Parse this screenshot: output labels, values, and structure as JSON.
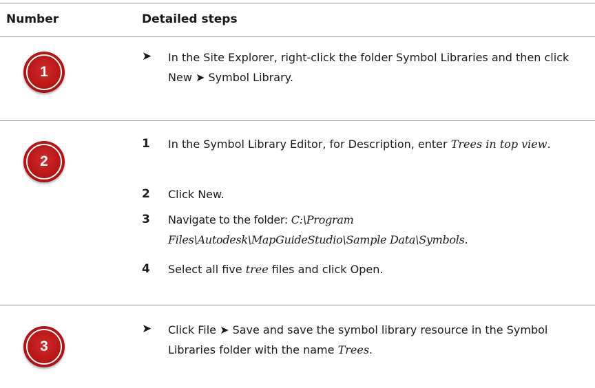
{
  "table": {
    "headers": {
      "number": "Number",
      "steps": "Detailed steps"
    },
    "rows": [
      {
        "number": "1",
        "bullet": "➤",
        "text": "In the Site Explorer, right-click the folder Symbol Libraries and then click New ➤ Symbol Library."
      },
      {
        "number": "2",
        "steps": [
          {
            "n": "1",
            "pre": "In the Symbol Library Editor, for Description, enter ",
            "em": "Trees in top view",
            "post": "."
          },
          {
            "n": "2",
            "pre": "Click New.",
            "em": "",
            "post": ""
          },
          {
            "n": "3",
            "pre": "Navigate to the folder: ",
            "em": "C:\\Program Files\\Autodesk\\MapGuideStudio\\Sample Data\\Symbols",
            "post": "."
          },
          {
            "n": "4",
            "pre": "Select all five ",
            "em": "tree",
            "post": " files and click Open."
          }
        ]
      },
      {
        "number": "3",
        "bullet": "➤",
        "pre": "Click File ➤ Save and save the symbol library resource in the Symbol Libraries folder with the name ",
        "em": "Trees",
        "post": "."
      }
    ]
  }
}
